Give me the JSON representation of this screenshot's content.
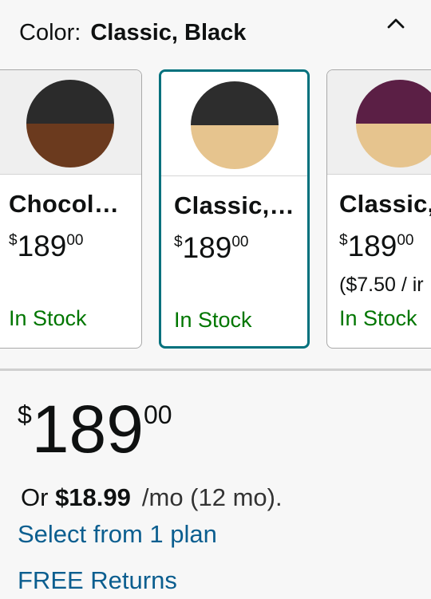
{
  "color": {
    "label": "Color:",
    "value": "Classic, Black"
  },
  "swatches": [
    {
      "name": "Chocol…",
      "price_symbol": "$",
      "price_whole": "189",
      "price_fraction": "00",
      "unit_price": "",
      "stock": "In Stock",
      "top_color": "#2b2b2b",
      "bottom_color": "#6b3a1e",
      "selected": false
    },
    {
      "name": "Classic,…",
      "price_symbol": "$",
      "price_whole": "189",
      "price_fraction": "00",
      "unit_price": "",
      "stock": "In Stock",
      "top_color": "#2d2d2d",
      "bottom_color": "#e6c48e",
      "selected": true
    },
    {
      "name": "Classic,",
      "price_symbol": "$",
      "price_whole": "189",
      "price_fraction": "00",
      "unit_price": "($7.50 / ir",
      "stock": "In Stock",
      "top_color": "#5b1f45",
      "bottom_color": "#e6c48e",
      "selected": false
    }
  ],
  "price": {
    "symbol": "$",
    "whole": "189",
    "fraction": "00"
  },
  "monthly": {
    "prefix": "Or",
    "amount": "$18.99",
    "suffix": "/mo (12 mo)."
  },
  "links": {
    "plan": "Select from 1 plan",
    "returns": "FREE Returns"
  },
  "colors": {
    "accent_teal": "#00717d",
    "in_stock_green": "#007600",
    "link_blue": "#0b5e8f",
    "highlight_green": "#c7ead8"
  }
}
